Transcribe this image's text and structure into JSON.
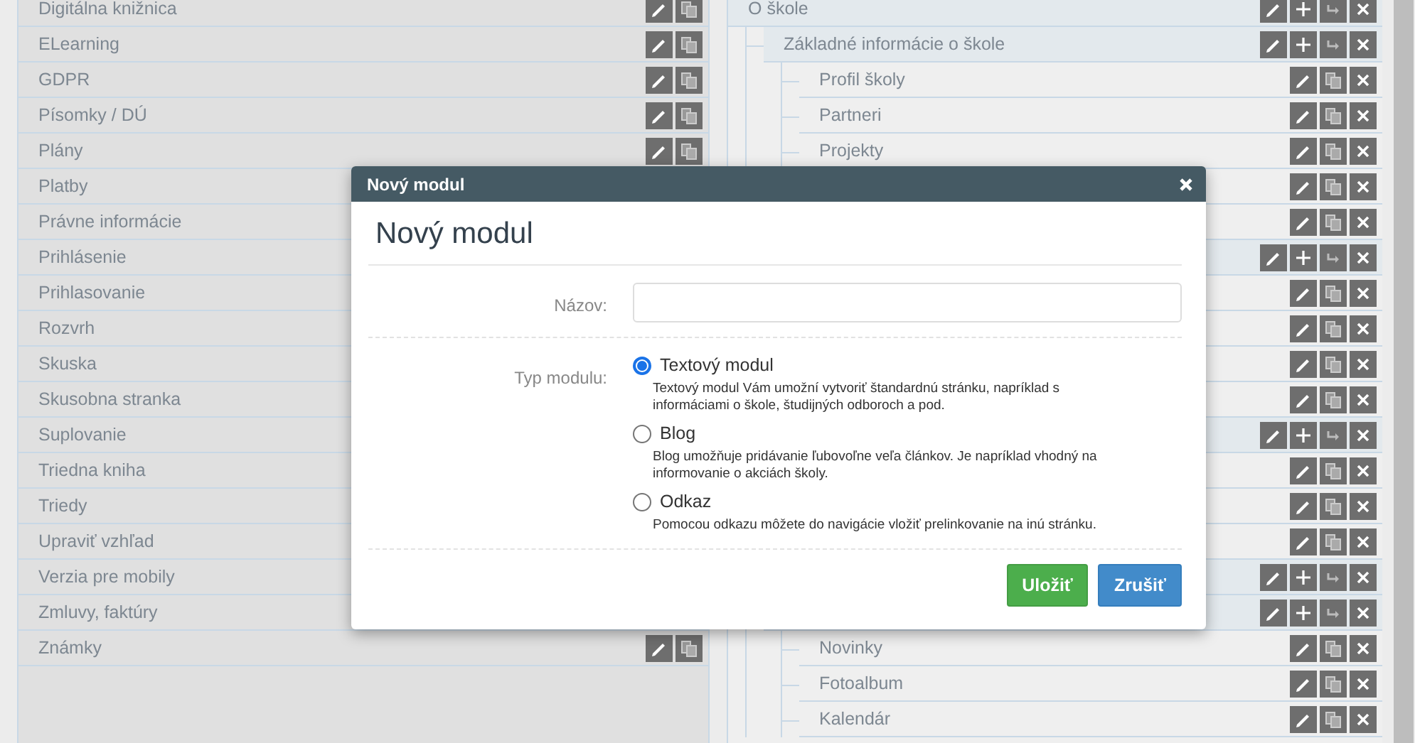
{
  "modules": [
    {
      "label": "Digitálna knižnica"
    },
    {
      "label": "ELearning"
    },
    {
      "label": "GDPR"
    },
    {
      "label": "Písomky / DÚ"
    },
    {
      "label": "Plány"
    },
    {
      "label": "Platby"
    },
    {
      "label": "Právne informácie"
    },
    {
      "label": "Prihlásenie"
    },
    {
      "label": "Prihlasovanie"
    },
    {
      "label": "Rozvrh"
    },
    {
      "label": "Skuska"
    },
    {
      "label": "Skusobna stranka"
    },
    {
      "label": "Suplovanie"
    },
    {
      "label": "Triedna kniha"
    },
    {
      "label": "Triedy"
    },
    {
      "label": "Upraviť vzhľad"
    },
    {
      "label": "Verzia pre mobily"
    },
    {
      "label": "Zmluvy, faktúry"
    },
    {
      "label": "Známky"
    }
  ],
  "tree": [
    {
      "kind": "folder",
      "label": "O škole",
      "children": [
        {
          "kind": "folder",
          "label": "Základné informácie o škole",
          "children": [
            {
              "kind": "page",
              "label": "Profil školy"
            },
            {
              "kind": "page",
              "label": "Partneri"
            },
            {
              "kind": "page",
              "label": "Projekty"
            },
            {
              "kind": "page"
            },
            {
              "kind": "page"
            }
          ]
        },
        {
          "kind": "folder",
          "children": [
            {
              "kind": "page"
            },
            {
              "kind": "page"
            },
            {
              "kind": "page"
            },
            {
              "kind": "page"
            }
          ]
        },
        {
          "kind": "folder",
          "children": [
            {
              "kind": "page"
            },
            {
              "kind": "page"
            },
            {
              "kind": "page"
            }
          ]
        },
        {
          "kind": "folder"
        },
        {
          "kind": "folder",
          "children": [
            {
              "kind": "page",
              "label": "Novinky"
            },
            {
              "kind": "page",
              "label": "Fotoalbum"
            },
            {
              "kind": "page",
              "label": "Kalendár"
            }
          ]
        }
      ]
    }
  ],
  "dialog": {
    "title": "Nový modul",
    "heading": "Nový modul",
    "name_label": "Názov:",
    "type_label": "Typ modulu:",
    "options": [
      {
        "label": "Textový modul",
        "description": "Textový modul Vám umožní vytvoriť štandardnú stránku, napríklad s informáciami o škole, študijných odboroch a pod.",
        "selected": true
      },
      {
        "label": "Blog",
        "description": "Blog umožňuje pridávanie ľubovoľne veľa článkov. Je napríklad vhodný na informovanie o akciách školy.",
        "selected": false
      },
      {
        "label": "Odkaz",
        "description": "Pomocou odkazu môžete do navigácie vložiť prelinkovanie na inú stránku.",
        "selected": false
      }
    ],
    "buttons": [
      {
        "label": "Uložiť",
        "kind": "primary"
      },
      {
        "label": "Zrušiť",
        "kind": "secondary"
      }
    ]
  }
}
